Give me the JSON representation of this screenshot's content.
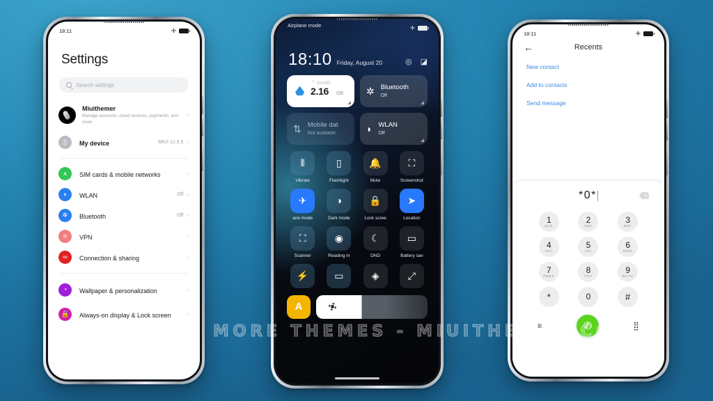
{
  "watermark": {
    "text": "VISIT FOR MORE THEMES - MIUITHEMER.COM"
  },
  "settings_phone": {
    "statusbar": {
      "time": "18:11",
      "airplane_icon": "✛",
      "battery_icon": "battery-full-icon"
    },
    "title": "Settings",
    "search": {
      "placeholder": "Search settings",
      "icon": "search-icon"
    },
    "account": {
      "name": "Miuithemer",
      "subtitle": "Manage accounts, cloud services, payments, and more",
      "avatar": "user-avatar"
    },
    "items": [
      {
        "label": "My device",
        "value": "MIUI 12.5.5",
        "icon": "device-icon",
        "color": "#b9bcc0"
      },
      {
        "label": "SIM cards & mobile networks",
        "value": "",
        "icon": "sim-signal-icon",
        "color": "#30c755"
      },
      {
        "label": "WLAN",
        "value": "Off",
        "icon": "wifi-icon",
        "color": "#2a7ef0"
      },
      {
        "label": "Bluetooth",
        "value": "Off",
        "icon": "bluetooth-icon",
        "color": "#2a7ef0"
      },
      {
        "label": "VPN",
        "value": "",
        "icon": "vpn-icon",
        "color": "#f08080"
      },
      {
        "label": "Connection & sharing",
        "value": "",
        "icon": "connection-sharing-icon",
        "color": "#e02222"
      },
      {
        "label": "Wallpaper & personalization",
        "value": "",
        "icon": "wallpaper-icon",
        "color": "#a020d8"
      },
      {
        "label": "Always-on display & Lock screen",
        "value": "",
        "icon": "lock-icon",
        "color": "#d120a8"
      }
    ],
    "chevron": "›"
  },
  "control_center_phone": {
    "statusbar": {
      "mode": "Airplane mode",
      "airplane_icon": "✛",
      "battery_icon": "battery-full-icon"
    },
    "clock": {
      "time": "18:10",
      "date": "Friday, August 20"
    },
    "header_actions": [
      {
        "icon": "settings-gear-icon",
        "glyph": "◎"
      },
      {
        "icon": "edit-icon",
        "glyph": "◪"
      }
    ],
    "big_tiles": [
      {
        "name": "data-usage",
        "style": "data",
        "head": "⌃ month",
        "value": "2.16",
        "unit": "GB",
        "icon": "water-drop-icon"
      },
      {
        "name": "bluetooth",
        "style": "dark",
        "label": "Bluetooth",
        "state": "Off",
        "glyph": "✲"
      },
      {
        "name": "mobile-data",
        "style": "dim",
        "label": "Mobile dat",
        "state": "Not available",
        "glyph": "⇅"
      },
      {
        "name": "wlan",
        "style": "dark",
        "label": "WLAN",
        "state": "Off",
        "glyph": "◗"
      }
    ],
    "toggles": [
      {
        "label": "Vibrate",
        "glyph": "⦀",
        "state": "lit"
      },
      {
        "label": "Flashlight",
        "glyph": "▯",
        "state": "lit"
      },
      {
        "label": "Mute",
        "glyph": "🔔",
        "state": "off"
      },
      {
        "label": "Screenshot",
        "glyph": "⛶",
        "state": "off"
      },
      {
        "label": "ane mode",
        "glyph": "✈",
        "state": "on"
      },
      {
        "label": "Dark mode",
        "glyph": "◑",
        "state": "lit"
      },
      {
        "label": "Lock scree",
        "glyph": "🔒",
        "state": "off"
      },
      {
        "label": "Location",
        "glyph": "➤",
        "state": "on"
      },
      {
        "label": "Scanner",
        "glyph": "⛶",
        "state": "lit"
      },
      {
        "label": "Reading m",
        "glyph": "◉",
        "state": "lit"
      },
      {
        "label": "DND",
        "glyph": "☾",
        "state": "off"
      },
      {
        "label": "Battery sav",
        "glyph": "▭",
        "state": "off"
      },
      {
        "label": "",
        "glyph": "⚡",
        "state": "lit"
      },
      {
        "label": "",
        "glyph": "▭",
        "state": "lit"
      },
      {
        "label": "",
        "glyph": "◈",
        "state": "off"
      },
      {
        "label": "",
        "glyph": "⤢",
        "state": "off"
      }
    ],
    "bottom": {
      "auto_label": "A",
      "brightness_icon": "brightness-sun-icon"
    }
  },
  "dialer_phone": {
    "statusbar": {
      "time": "18:11",
      "airplane_icon": "✛",
      "battery_icon": "battery-full-icon"
    },
    "title": "Recents",
    "back_icon": "←",
    "links": [
      "New contact",
      "Add to contacts",
      "Send message"
    ],
    "input": {
      "value": "*0*",
      "delete_icon": "backspace-icon"
    },
    "keys": [
      {
        "digit": "1",
        "letters": "QLD"
      },
      {
        "digit": "2",
        "letters": "ABC"
      },
      {
        "digit": "3",
        "letters": "DEF"
      },
      {
        "digit": "4",
        "letters": "GHI"
      },
      {
        "digit": "5",
        "letters": "JKL"
      },
      {
        "digit": "6",
        "letters": "MNO"
      },
      {
        "digit": "7",
        "letters": "PQRS"
      },
      {
        "digit": "8",
        "letters": "TUV"
      },
      {
        "digit": "9",
        "letters": "WXYZ"
      },
      {
        "digit": "*",
        "letters": ""
      },
      {
        "digit": "0",
        "letters": "+"
      },
      {
        "digit": "#",
        "letters": ""
      }
    ],
    "actions": {
      "menu_icon": "≡",
      "call_icon": "📞",
      "keypad_icon": "⣿"
    }
  }
}
